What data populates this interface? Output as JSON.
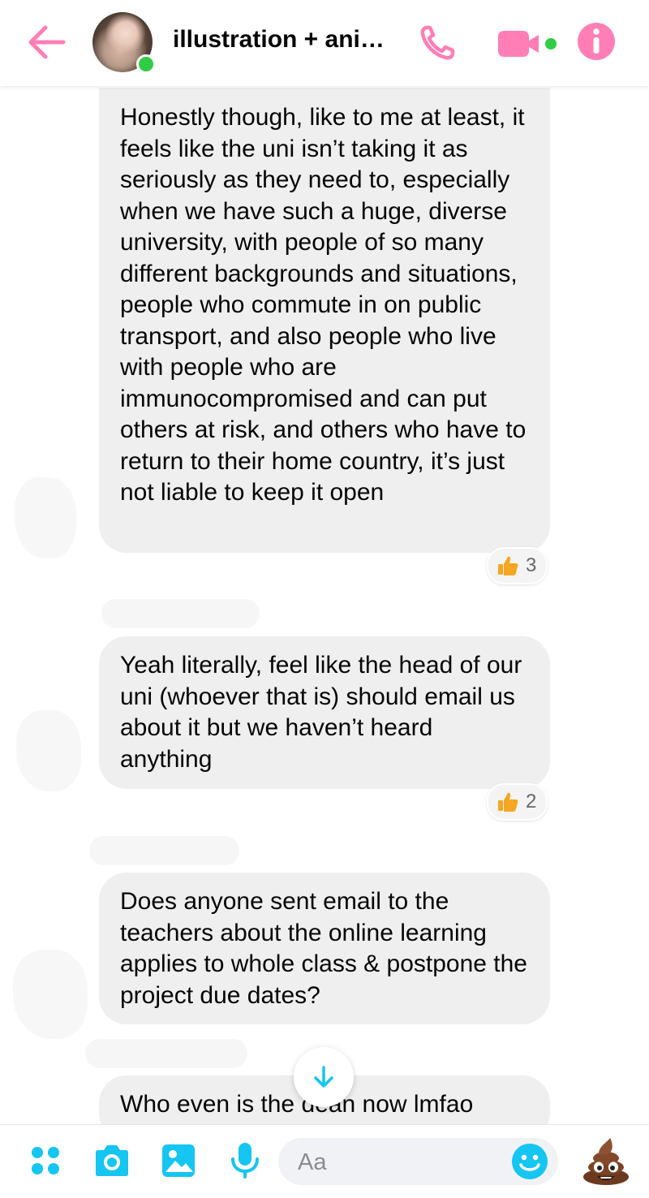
{
  "header": {
    "title": "illustration + ani…",
    "icons": {
      "back": "arrow-left-icon",
      "call": "phone-icon",
      "video": "video-camera-icon",
      "info": "info-icon"
    },
    "accent_color": "#ff7eb6",
    "online_color": "#31cc46"
  },
  "messages": [
    {
      "text": "Honestly though, like to me at least, it feels like the uni isn’t taking it as seriously as they need to, especially when we have such a huge, diverse university, with people of so many different backgrounds and situations, people who commute in on public transport, and also people who live with people who are immunocompromised and can put others at risk, and others who have to return to their home country, it’s just not liable to keep it open",
      "reaction_count": "3"
    },
    {
      "text": "Yeah literally, feel like the head of our uni (whoever that is) should email us about it but we haven’t heard anything",
      "reaction_count": "2"
    },
    {
      "text": "Does anyone sent email to the teachers about the online learning applies to whole class & postpone the project due dates?"
    },
    {
      "text": "Who even is the dean now lmfao"
    }
  ],
  "composer": {
    "placeholder": "Aa",
    "accent_color": "#15c5f2",
    "icons": [
      "apps-icon",
      "camera-icon",
      "image-icon",
      "microphone-icon",
      "emoji-icon",
      "poop-emoji-icon"
    ]
  }
}
